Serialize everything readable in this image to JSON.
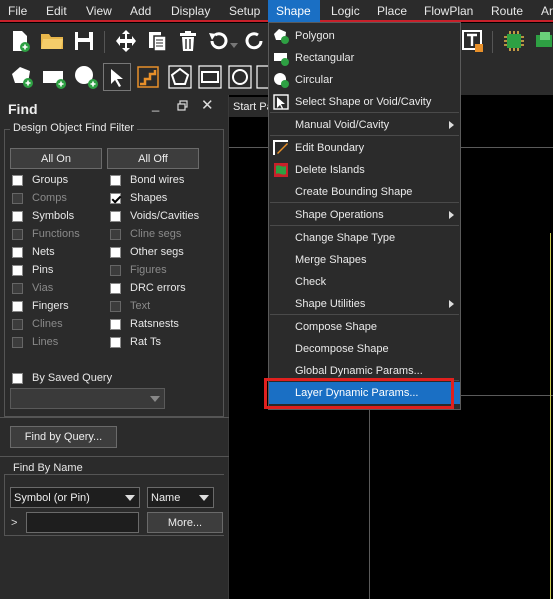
{
  "menubar": {
    "items": [
      "File",
      "Edit",
      "View",
      "Add",
      "Display",
      "Setup",
      "Shape",
      "Logic",
      "Place",
      "FlowPlan",
      "Route",
      "Ar"
    ],
    "active": "Shape"
  },
  "canvas": {
    "tab_label": "Start Pa"
  },
  "find_panel": {
    "title": "Find",
    "filter_label": "Design Object Find Filter",
    "all_on": "All On",
    "all_off": "All Off",
    "left_checks": [
      {
        "label": "Groups",
        "enabled": true,
        "checked": false
      },
      {
        "label": "Comps",
        "enabled": false,
        "checked": false
      },
      {
        "label": "Symbols",
        "enabled": true,
        "checked": false
      },
      {
        "label": "Functions",
        "enabled": false,
        "checked": false
      },
      {
        "label": "Nets",
        "enabled": true,
        "checked": false
      },
      {
        "label": "Pins",
        "enabled": true,
        "checked": false
      },
      {
        "label": "Vias",
        "enabled": false,
        "checked": false
      },
      {
        "label": "Fingers",
        "enabled": true,
        "checked": false
      },
      {
        "label": "Clines",
        "enabled": false,
        "checked": false
      },
      {
        "label": "Lines",
        "enabled": false,
        "checked": false
      }
    ],
    "right_checks": [
      {
        "label": "Bond wires",
        "enabled": true,
        "checked": false
      },
      {
        "label": "Shapes",
        "enabled": true,
        "checked": true
      },
      {
        "label": "Voids/Cavities",
        "enabled": true,
        "checked": false
      },
      {
        "label": "Cline segs",
        "enabled": false,
        "checked": false
      },
      {
        "label": "Other segs",
        "enabled": true,
        "checked": false
      },
      {
        "label": "Figures",
        "enabled": false,
        "checked": false
      },
      {
        "label": "DRC errors",
        "enabled": true,
        "checked": false
      },
      {
        "label": "Text",
        "enabled": false,
        "checked": false
      },
      {
        "label": "Ratsnests",
        "enabled": true,
        "checked": false
      },
      {
        "label": "Rat Ts",
        "enabled": true,
        "checked": false
      }
    ],
    "saved_query_label": "By Saved Query",
    "find_by_query": "Find by Query...",
    "find_by_name_label": "Find By Name",
    "type_value": "Symbol (or Pin)",
    "field_value": "Name",
    "prompt": ">",
    "more_button": "More..."
  },
  "shape_menu": {
    "items": [
      {
        "label": "Polygon",
        "icon": "polygon-add-icon"
      },
      {
        "label": "Rectangular",
        "icon": "rectangle-add-icon"
      },
      {
        "label": "Circular",
        "icon": "circle-add-icon"
      },
      {
        "label": "Select Shape or Void/Cavity",
        "icon": "select-shape-icon"
      },
      {
        "label": "Manual Void/Cavity",
        "submenu": true
      },
      {
        "label": "Edit Boundary",
        "icon": "edit-boundary-icon"
      },
      {
        "label": "Delete Islands",
        "icon": "delete-islands-icon"
      },
      {
        "label": "Create Bounding Shape"
      },
      {
        "label": "Shape Operations",
        "submenu": true
      },
      {
        "label": "Change Shape Type"
      },
      {
        "label": "Merge Shapes"
      },
      {
        "label": "Check"
      },
      {
        "label": "Shape Utilities",
        "submenu": true
      },
      {
        "label": "Compose Shape"
      },
      {
        "label": "Decompose Shape"
      },
      {
        "label": "Global Dynamic Params..."
      },
      {
        "label": "Layer Dynamic Params...",
        "highlighted": true
      }
    ]
  }
}
